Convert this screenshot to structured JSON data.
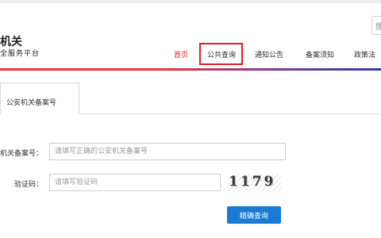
{
  "header": {
    "brand_title": "机关",
    "brand_subtitle": "全服务平台",
    "search_stub": "搜"
  },
  "nav": {
    "items": [
      {
        "label": "首页",
        "active": true
      },
      {
        "label": "公共查询",
        "active": false,
        "highlighted": true
      },
      {
        "label": "通知公告",
        "active": false
      },
      {
        "label": "备案须知",
        "active": false
      },
      {
        "label": "政策法",
        "active": false
      }
    ]
  },
  "tabs": [
    {
      "label": "公安机关备案号"
    }
  ],
  "form": {
    "record_label": "机关备案号：",
    "record_placeholder": "请填写正确的公安机关备案号",
    "captcha_label": "验证码：",
    "captcha_placeholder": "请填写验证码",
    "captcha_code": "1179",
    "submit_label": "精确查询"
  },
  "colors": {
    "accent_red": "#e02020",
    "button_blue": "#1a7bd6"
  }
}
